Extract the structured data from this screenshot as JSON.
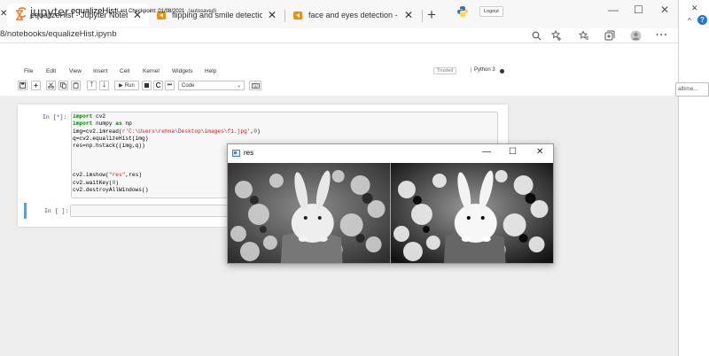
{
  "browser": {
    "tabs": [
      {
        "title": "equalizeHist - Jupyter Notebook",
        "active": true
      },
      {
        "title": "flipping and smile detection - Ju",
        "active": false
      },
      {
        "title": "face and eyes detection - Jupyte",
        "active": false
      }
    ],
    "close_glyph": "✕",
    "new_tab_glyph": "+",
    "address": "8/notebooks/equalizeHist.ipynb",
    "window_controls": {
      "minimize": "—",
      "maximize": "☐",
      "close": "✕"
    },
    "toolbar_icons": [
      "zoom-icon",
      "favorite-add-icon",
      "favorites-icon",
      "collections-icon",
      "profile-icon",
      "more-icon"
    ]
  },
  "jupyter": {
    "logo_text": "jupyter",
    "notebook_name": "equalizeHist",
    "checkpoint": "Last Checkpoint: 01/08/2021",
    "autosaved": "(autosaved)",
    "logout": "Logout",
    "trusted": "Trusted",
    "kernel": "Python 3",
    "menu": [
      "File",
      "Edit",
      "View",
      "Insert",
      "Cell",
      "Kernel",
      "Widgets",
      "Help"
    ],
    "toolbar": {
      "run_label": "Run",
      "cell_type": "Code"
    }
  },
  "cells": [
    {
      "prompt": "In [*]:",
      "lines": [
        [
          [
            "kw",
            "import"
          ],
          [
            "fn",
            " cv2"
          ]
        ],
        [
          [
            "kw",
            "import"
          ],
          [
            "fn",
            " numpy "
          ],
          [
            "kw",
            "as"
          ],
          [
            "fn",
            " np"
          ]
        ],
        [
          [
            "fn",
            "img=cv2.imread("
          ],
          [
            "str",
            "r'C:\\Users\\rehna\\Desktop\\images\\f1.jpg'"
          ],
          [
            "fn",
            ","
          ],
          [
            "num",
            "0"
          ],
          [
            "fn",
            ")"
          ]
        ],
        [
          [
            "fn",
            "q=cv2.equalizeHist(img)"
          ]
        ],
        [
          [
            "fn",
            "res=np.hstack((img,q))"
          ]
        ],
        [
          [
            "fn",
            ""
          ]
        ],
        [
          [
            "fn",
            ""
          ]
        ],
        [
          [
            "fn",
            ""
          ]
        ],
        [
          [
            "fn",
            "cv2.imshow("
          ],
          [
            "str",
            "\"res\""
          ],
          [
            "fn",
            ",res)"
          ]
        ],
        [
          [
            "fn",
            "cv2.waitKey("
          ],
          [
            "num",
            "0"
          ],
          [
            "fn",
            ")"
          ]
        ],
        [
          [
            "fn",
            "cv2.destroyAllWindows()"
          ]
        ]
      ]
    },
    {
      "prompt": "In [ ]:",
      "lines": []
    }
  ],
  "cv_window": {
    "title": "res",
    "controls": {
      "minimize": "—",
      "maximize": "☐",
      "close": "✕"
    }
  },
  "side_panel": {
    "close": "✕",
    "chevron": "^",
    "help": "?",
    "field_text": "altime..."
  },
  "colors": {
    "accent": "#42a5f5",
    "prompt": "#303f9f",
    "keyword": "#008000",
    "string": "#ba2121",
    "jupyter_orange": "#f37726",
    "tab_favicon": "#f29100"
  }
}
